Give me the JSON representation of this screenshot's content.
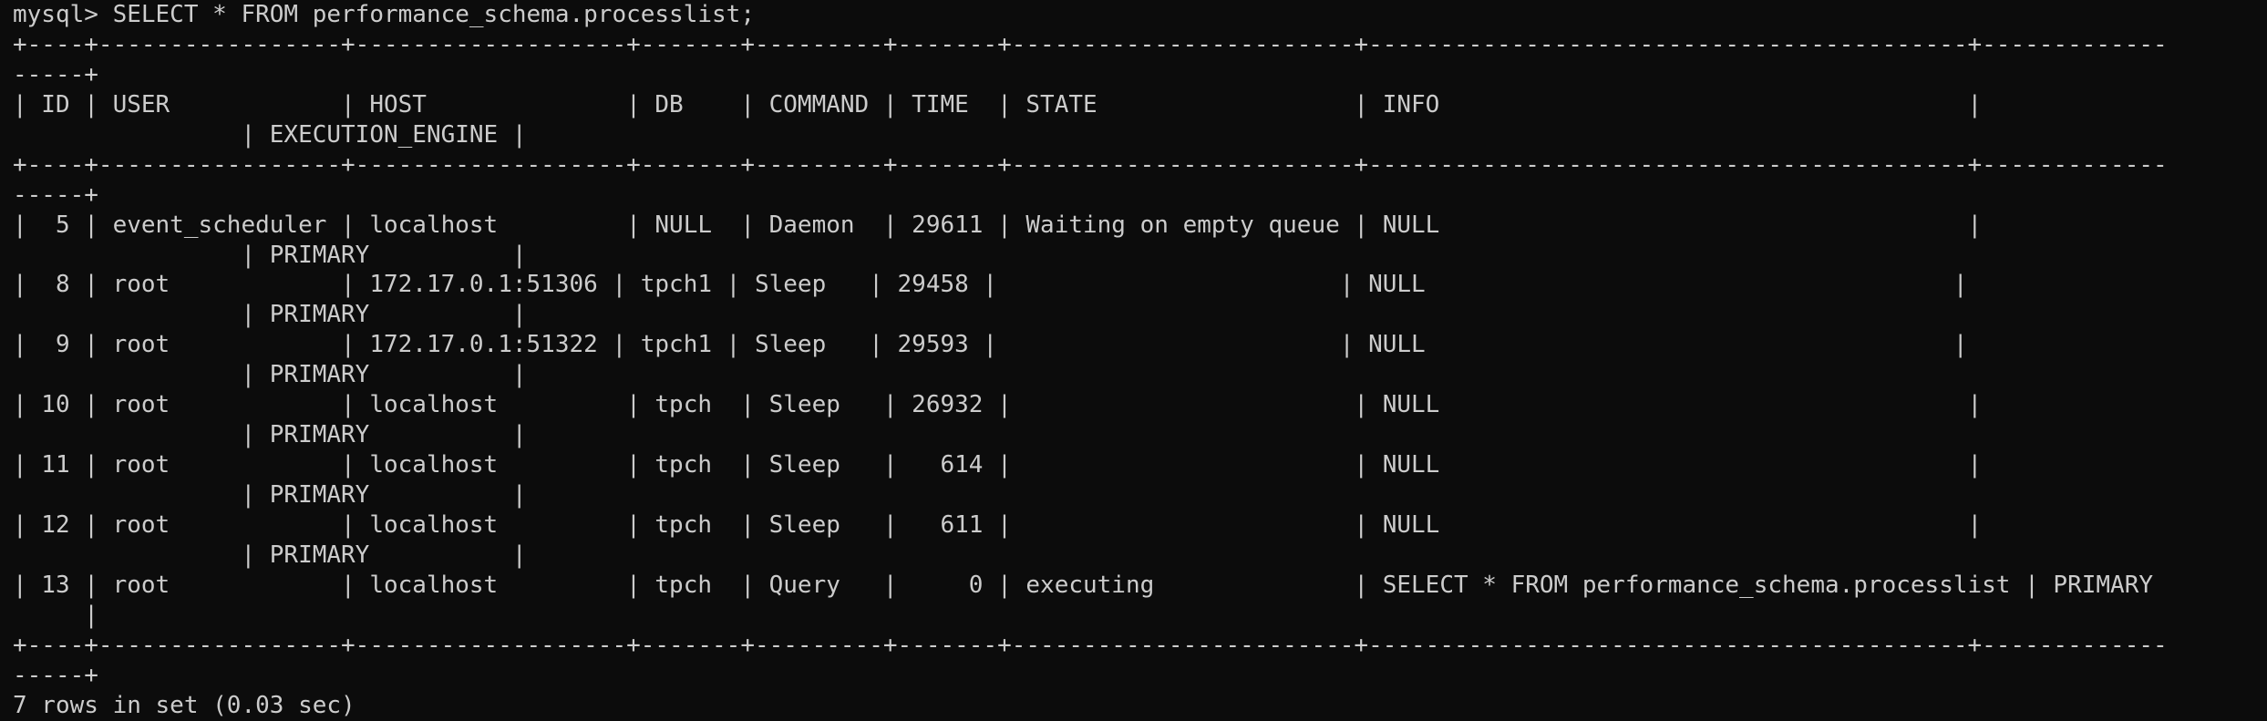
{
  "terminal": {
    "lines": [
      "mysql> SELECT * FROM performance_schema.processlist;",
      "+----+-----------------+-------------------+-------+---------+-------+------------------------+------------------------------------------+-------------",
      "-----+",
      "| ID | USER            | HOST              | DB    | COMMAND | TIME  | STATE                  | INFO                                     | ",
      "                | EXECUTION_ENGINE |",
      "+----+-----------------+-------------------+-------+---------+-------+------------------------+------------------------------------------+-------------",
      "-----+",
      "|  5 | event_scheduler | localhost         | NULL  | Daemon  | 29611 | Waiting on empty queue | NULL                                     |",
      "                | PRIMARY          |",
      "|  8 | root            | 172.17.0.1:51306 | tpch1 | Sleep   | 29458 |                        | NULL                                     |",
      "                | PRIMARY          |",
      "|  9 | root            | 172.17.0.1:51322 | tpch1 | Sleep   | 29593 |                        | NULL                                     |",
      "                | PRIMARY          |",
      "| 10 | root            | localhost         | tpch  | Sleep   | 26932 |                        | NULL                                     |",
      "                | PRIMARY          |",
      "| 11 | root            | localhost         | tpch  | Sleep   |   614 |                        | NULL                                     |",
      "                | PRIMARY          |",
      "| 12 | root            | localhost         | tpch  | Sleep   |   611 |                        | NULL                                     |",
      "                | PRIMARY          |",
      "| 13 | root            | localhost         | tpch  | Query   |     0 | executing              | SELECT * FROM performance_schema.processlist | PRIMARY",
      "     |",
      "+----+-----------------+-------------------+-------+---------+-------+------------------------+------------------------------------------+-------------",
      "-----+",
      "7 rows in set (0.03 sec)"
    ]
  }
}
